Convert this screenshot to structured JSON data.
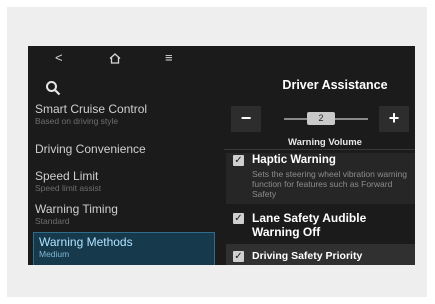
{
  "topbar": {
    "back_glyph": "<",
    "home_glyph": "⌂",
    "menu_glyph": "≡"
  },
  "icons": {
    "back": "back-icon",
    "home": "home-icon",
    "menu": "menu-icon",
    "search": "search-icon"
  },
  "panel": {
    "title": "Driver Assistance"
  },
  "sidebar": {
    "items": [
      {
        "label": "Smart Cruise Control",
        "sub": "Based on driving style"
      },
      {
        "label": "Driving Convenience",
        "sub": ""
      },
      {
        "label": "Speed Limit",
        "sub": "Speed limit assist"
      },
      {
        "label": "Warning Timing",
        "sub": "Standard"
      },
      {
        "label": "Warning Methods",
        "sub": "Medium",
        "selected": true
      }
    ]
  },
  "volume": {
    "minus_label": "−",
    "plus_label": "+",
    "level": "2",
    "label": "Warning Volume"
  },
  "options": {
    "haptic": {
      "title": "Haptic Warning",
      "desc": "Sets the steering wheel vibration warning function for features such as Forward Safety",
      "checked": true
    },
    "lane": {
      "title": "Lane Safety Audible Warning Off",
      "checked": true
    },
    "priority": {
      "title": "Driving Safety Priority",
      "checked": true
    },
    "check_glyph": "✓"
  },
  "colors": {
    "screen_bg": "#1b1b1b",
    "selected_bg": "#17394c",
    "selected_text": "#aee3ff"
  }
}
